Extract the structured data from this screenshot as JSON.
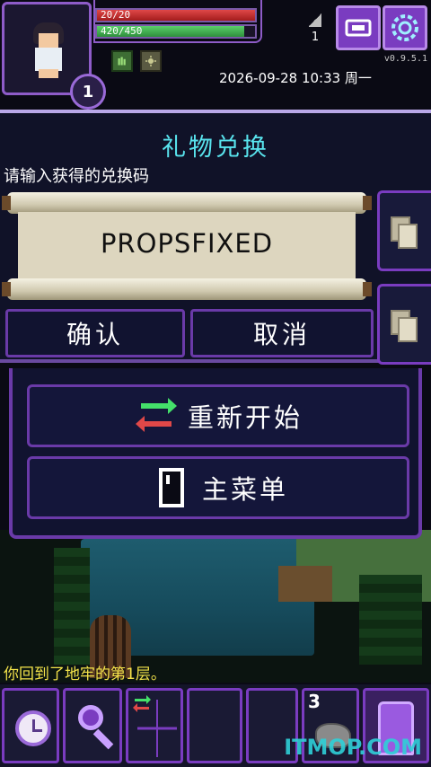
{
  "hud": {
    "hp_text": "20/20",
    "hp_fraction": 1.0,
    "xp_text": "420/450",
    "xp_fraction": 0.93,
    "hero_level": "1",
    "depth": "1",
    "version": "v0.9.5.1",
    "datetime": "2026-09-28 10:33 周一",
    "buffs": [
      "plant-buff-icon",
      "sun-buff-icon"
    ]
  },
  "dialog": {
    "title": "礼物兑换",
    "prompt": "请输入获得的兑换码",
    "code_value": "PROPSFIXED",
    "confirm_label": "确认",
    "cancel_label": "取消"
  },
  "menu": {
    "restart_label": "重新开始",
    "main_menu_label": "主菜单"
  },
  "log": {
    "message": "你回到了地牢的第1层。"
  },
  "toolbar": {
    "quickslot_count": "3"
  },
  "watermark": "ITMOP.COM",
  "colors": {
    "accent_purple": "#7a3cc0",
    "title_cyan": "#59e4ee",
    "log_yellow": "#f2e24a",
    "hp_red": "#e04848",
    "xp_green": "#5ad06a"
  }
}
